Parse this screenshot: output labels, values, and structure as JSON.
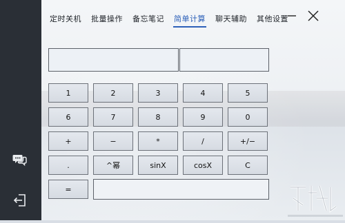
{
  "nav": {
    "tabs": [
      {
        "label": "定时关机"
      },
      {
        "label": "批量操作"
      },
      {
        "label": "备忘笔记"
      },
      {
        "label": "简单计算",
        "active": true
      },
      {
        "label": "聊天辅助"
      },
      {
        "label": "其他设置"
      }
    ]
  },
  "sidebar": {
    "chat_icon": "chat-bubbles-icon",
    "logout_icon": "logout-icon"
  },
  "window": {
    "minimize_icon": "minimize-icon",
    "close_icon": "close-icon"
  },
  "calculator": {
    "display_left_value": "",
    "display_right_value": "",
    "result_value": "",
    "keys": {
      "row1": [
        "1",
        "2",
        "3",
        "4",
        "5"
      ],
      "row2": [
        "6",
        "7",
        "8",
        "9",
        "0"
      ],
      "row3": [
        "+",
        "−",
        "*",
        "/",
        "+/−"
      ],
      "row4": [
        ".",
        "^幂",
        "sinX",
        "cosX",
        "C"
      ],
      "row5": [
        "="
      ]
    }
  },
  "colors": {
    "active_tab": "#2b5fb8",
    "sidebar_bg": "#2a2f36"
  }
}
